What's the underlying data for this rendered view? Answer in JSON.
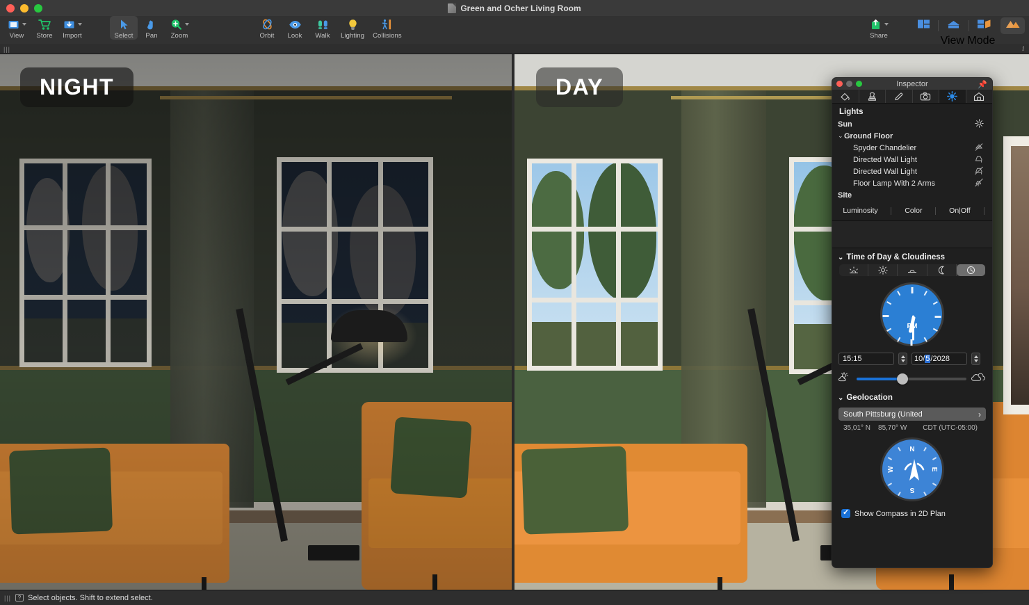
{
  "window": {
    "title": "Green and Ocher Living Room",
    "doc_icon": "document-icon"
  },
  "toolbar": {
    "groups": [
      {
        "items": [
          {
            "label": "View",
            "icon": "view-icon",
            "dropdown": true
          },
          {
            "label": "Store",
            "icon": "cart-icon",
            "dropdown": false
          },
          {
            "label": "Import",
            "icon": "import-icon",
            "dropdown": true
          }
        ]
      },
      {
        "items": [
          {
            "label": "Select",
            "icon": "cursor-icon",
            "dropdown": false,
            "selected": true
          },
          {
            "label": "Pan",
            "icon": "hand-icon",
            "dropdown": false
          },
          {
            "label": "Zoom",
            "icon": "magnifier-plus-icon",
            "dropdown": true
          }
        ]
      },
      {
        "items": [
          {
            "label": "Orbit",
            "icon": "orbit-icon",
            "dropdown": false
          },
          {
            "label": "Look",
            "icon": "eye-icon",
            "dropdown": false
          },
          {
            "label": "Walk",
            "icon": "footsteps-icon",
            "dropdown": false
          },
          {
            "label": "Lighting",
            "icon": "bulb-icon",
            "dropdown": false
          },
          {
            "label": "Collisions",
            "icon": "collisions-icon",
            "dropdown": false
          }
        ]
      }
    ],
    "right": {
      "share_label": "Share",
      "share_icon": "share-upload-icon",
      "view_mode_label": "View Mode",
      "view_modes": [
        {
          "icon": "plan-view-icon",
          "selected": false
        },
        {
          "icon": "elevation-view-icon",
          "selected": false
        },
        {
          "icon": "split-view-icon",
          "selected": false
        },
        {
          "icon": "render-view-icon",
          "selected": true
        }
      ]
    }
  },
  "viewports": {
    "left_badge": "NIGHT",
    "right_badge": "DAY"
  },
  "inspector": {
    "title": "Inspector",
    "pin_icon": "pin-icon",
    "tabs": [
      {
        "icon": "paint-bucket-icon",
        "active": false
      },
      {
        "icon": "stamp-icon",
        "active": false
      },
      {
        "icon": "pencil-icon",
        "active": false
      },
      {
        "icon": "camera-icon",
        "active": false
      },
      {
        "icon": "sun-icon",
        "active": true
      },
      {
        "icon": "house-icon",
        "active": false
      }
    ],
    "lights": {
      "section_title": "Lights",
      "rows": [
        {
          "name": "Sun",
          "icon": "sun-small-icon",
          "level": 0,
          "group": true,
          "disclosure": ""
        },
        {
          "name": "Ground Floor",
          "icon": "",
          "level": 0,
          "group": true,
          "disclosure": "⌄"
        },
        {
          "name": "Spyder Chandelier",
          "icon": "chandelier-off-icon",
          "level": 1,
          "group": false,
          "disclosure": ""
        },
        {
          "name": "Directed Wall Light",
          "icon": "wall-light-on-icon",
          "level": 1,
          "group": false,
          "disclosure": ""
        },
        {
          "name": "Directed Wall Light",
          "icon": "wall-light-off-icon",
          "level": 1,
          "group": false,
          "disclosure": ""
        },
        {
          "name": "Floor Lamp With 2 Arms",
          "icon": "floor-lamp-off-icon",
          "level": 1,
          "group": false,
          "disclosure": ""
        },
        {
          "name": "Site",
          "icon": "",
          "level": 0,
          "group": true,
          "disclosure": ""
        }
      ],
      "segments": [
        "Luminosity",
        "Color",
        "On|Off"
      ]
    },
    "time_of_day": {
      "header": "Time of Day & Cloudiness",
      "presets": [
        {
          "icon": "sunrise-icon",
          "selected": false
        },
        {
          "icon": "noon-sun-icon",
          "selected": false
        },
        {
          "icon": "sunset-icon",
          "selected": false
        },
        {
          "icon": "moon-icon",
          "selected": false
        },
        {
          "icon": "clock-icon",
          "selected": true
        }
      ],
      "clock": {
        "meridiem": "PM",
        "hour": 3,
        "minute": 15
      },
      "time_value": "15:15",
      "date_month": "10/",
      "date_day": "5",
      "date_year": "/2028",
      "cloudiness_percent": 40,
      "cloudiness_low_icon": "sun-cloud-icon",
      "cloudiness_high_icon": "cloud-icon"
    },
    "geolocation": {
      "header": "Geolocation",
      "place": "South Pittsburg (United",
      "chevron_icon": "chevron-right-icon",
      "latitude": "35,01° N",
      "longitude": "85,70° W",
      "timezone": "CDT (UTC-05:00)",
      "compass": {
        "n": "N",
        "e": "E",
        "s": "S",
        "w": "W"
      },
      "checkbox_label": "Show Compass in 2D Plan",
      "checkbox_checked": true
    }
  },
  "statusbar": {
    "grip_icon": "resize-grip-icon",
    "help_icon": "help-icon",
    "message": "Select objects. Shift to extend select."
  },
  "colors": {
    "accent_blue": "#1a72d8",
    "clock_blue": "#2b7fd4",
    "compass_blue": "#3d84d6",
    "toolbar_bg": "#323232",
    "titlebar_bg": "#3a3a3a",
    "panel_bg": "#1f1f1f"
  }
}
